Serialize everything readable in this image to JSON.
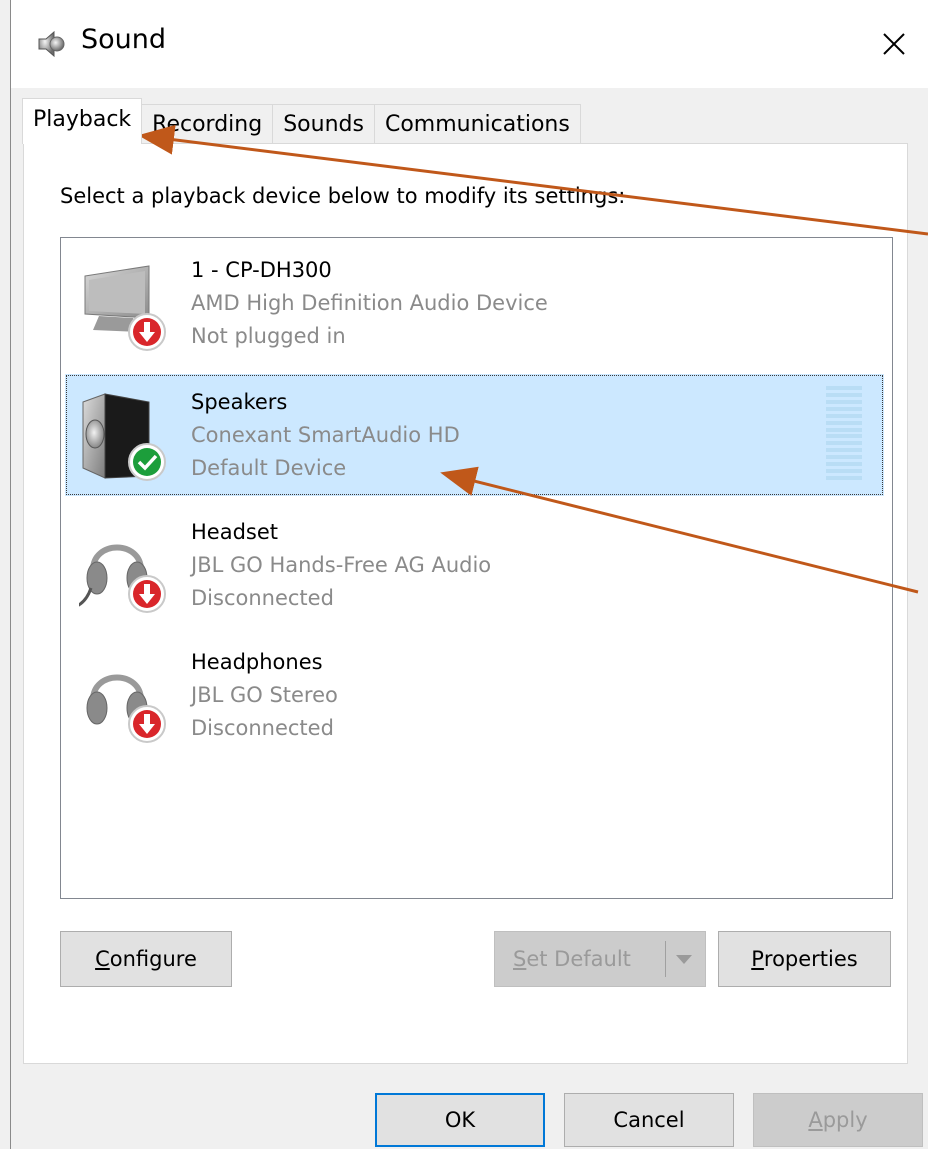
{
  "window": {
    "title": "Sound",
    "icon": "speaker-icon",
    "close_icon": "close-icon"
  },
  "tabs": [
    {
      "label": "Playback",
      "active": true
    },
    {
      "label": "Recording",
      "active": false
    },
    {
      "label": "Sounds",
      "active": false
    },
    {
      "label": "Communications",
      "active": false
    }
  ],
  "instruction": "Select a playback device below to modify its settings:",
  "devices": [
    {
      "name": "1 - CP-DH300",
      "driver": "AMD High Definition Audio Device",
      "status": "Not plugged in",
      "icon": "monitor-icon",
      "badge": "red-down-arrow-icon",
      "selected": false
    },
    {
      "name": "Speakers",
      "driver": "Conexant SmartAudio HD",
      "status": "Default Device",
      "icon": "speaker-icon",
      "badge": "green-check-icon",
      "selected": true
    },
    {
      "name": "Headset",
      "driver": "JBL GO Hands-Free AG Audio",
      "status": "Disconnected",
      "icon": "headset-icon",
      "badge": "red-down-arrow-icon",
      "selected": false
    },
    {
      "name": "Headphones",
      "driver": "JBL GO Stereo",
      "status": "Disconnected",
      "icon": "headphones-icon",
      "badge": "red-down-arrow-icon",
      "selected": false
    }
  ],
  "buttons": {
    "configure": {
      "prefix": "C",
      "rest": "onfigure",
      "enabled": true
    },
    "set_default": {
      "prefix": "S",
      "rest": "et Default",
      "enabled": false
    },
    "properties": {
      "prefix": "P",
      "rest": "roperties",
      "enabled": true
    },
    "ok": "OK",
    "cancel": "Cancel",
    "apply": {
      "prefix": "A",
      "rest": "pply",
      "enabled": false
    }
  },
  "colors": {
    "selection": "#cce8ff",
    "accent_border": "#0078d7",
    "annotation_arrow": "#c0581a",
    "badge_red": "#d9262b",
    "badge_green": "#1c9e3b"
  }
}
